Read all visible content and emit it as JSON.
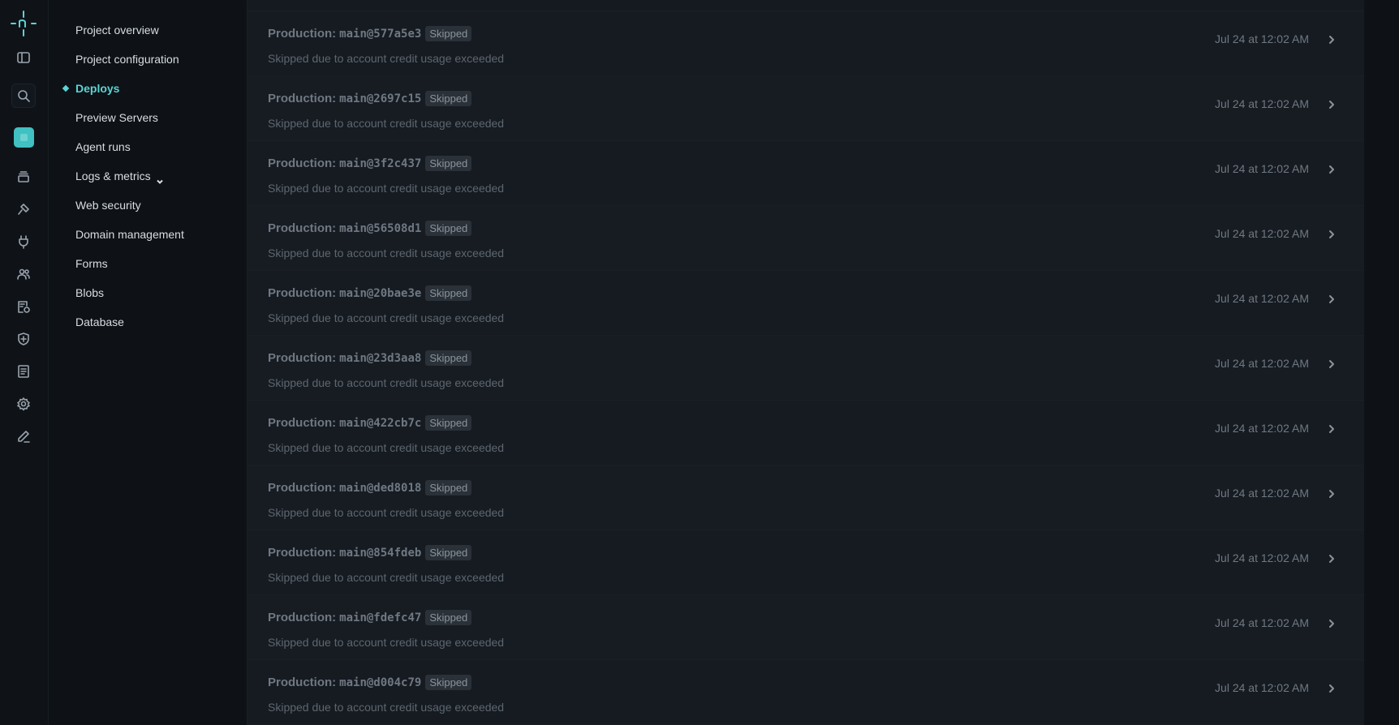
{
  "rail": {
    "icons": [
      "netlify-logo-icon",
      "sidebar-toggle-icon",
      "search-icon",
      "team-avatar",
      "layers-icon",
      "build-icon",
      "plug-icon",
      "users-icon",
      "audit-log-icon",
      "shield-icon",
      "docs-icon",
      "gear-icon",
      "edit-icon"
    ],
    "accent": "#41c1c1"
  },
  "nav": {
    "items": [
      {
        "label": "Project overview"
      },
      {
        "label": "Project configuration"
      },
      {
        "label": "Deploys",
        "active": true
      },
      {
        "label": "Preview Servers"
      },
      {
        "label": "Agent runs"
      },
      {
        "label": "Logs & metrics",
        "has_chevron": true
      },
      {
        "label": "Web security"
      },
      {
        "label": "Domain management"
      },
      {
        "label": "Forms"
      },
      {
        "label": "Blobs"
      },
      {
        "label": "Database"
      }
    ]
  },
  "deploys": {
    "prefix": "Production:",
    "rows": [
      {
        "ref": "main@577a5e3",
        "status": "Skipped",
        "message": "Skipped due to account credit usage exceeded",
        "time": "Jul 24 at 12:02 AM"
      },
      {
        "ref": "main@2697c15",
        "status": "Skipped",
        "message": "Skipped due to account credit usage exceeded",
        "time": "Jul 24 at 12:02 AM"
      },
      {
        "ref": "main@3f2c437",
        "status": "Skipped",
        "message": "Skipped due to account credit usage exceeded",
        "time": "Jul 24 at 12:02 AM"
      },
      {
        "ref": "main@56508d1",
        "status": "Skipped",
        "message": "Skipped due to account credit usage exceeded",
        "time": "Jul 24 at 12:02 AM"
      },
      {
        "ref": "main@20bae3e",
        "status": "Skipped",
        "message": "Skipped due to account credit usage exceeded",
        "time": "Jul 24 at 12:02 AM"
      },
      {
        "ref": "main@23d3aa8",
        "status": "Skipped",
        "message": "Skipped due to account credit usage exceeded",
        "time": "Jul 24 at 12:02 AM"
      },
      {
        "ref": "main@422cb7c",
        "status": "Skipped",
        "message": "Skipped due to account credit usage exceeded",
        "time": "Jul 24 at 12:02 AM"
      },
      {
        "ref": "main@ded8018",
        "status": "Skipped",
        "message": "Skipped due to account credit usage exceeded",
        "time": "Jul 24 at 12:02 AM"
      },
      {
        "ref": "main@854fdeb",
        "status": "Skipped",
        "message": "Skipped due to account credit usage exceeded",
        "time": "Jul 24 at 12:02 AM"
      },
      {
        "ref": "main@fdefc47",
        "status": "Skipped",
        "message": "Skipped due to account credit usage exceeded",
        "time": "Jul 24 at 12:02 AM"
      },
      {
        "ref": "main@d004c79",
        "status": "Skipped",
        "message": "Skipped due to account credit usage exceeded",
        "time": "Jul 24 at 12:02 AM"
      }
    ]
  }
}
